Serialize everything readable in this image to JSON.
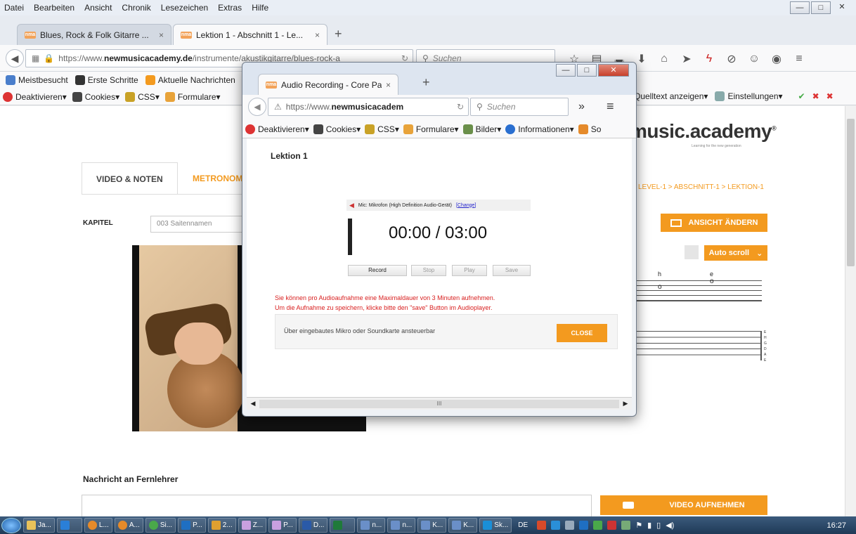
{
  "menubar": {
    "items": [
      "Datei",
      "Bearbeiten",
      "Ansicht",
      "Chronik",
      "Lesezeichen",
      "Extras",
      "Hilfe"
    ]
  },
  "tabs": [
    {
      "label": "Blues, Rock & Folk Gitarre ...",
      "favicon": "nma"
    },
    {
      "label": "Lektion 1 - Abschnitt 1 - Le...",
      "favicon": "nma"
    }
  ],
  "navbar": {
    "url_prefix": "https://www.",
    "url_domain": "newmusicacademy.de",
    "url_path": "/instrumente/akustikgitarre/blues-rock-a",
    "search_placeholder": "Suchen"
  },
  "bookmarks": [
    "Meistbesucht",
    "Erste Schritte",
    "Aktuelle Nachrichten"
  ],
  "webdev": [
    "Deaktivieren",
    "Cookies",
    "CSS",
    "Formulare"
  ],
  "webdev_right": [
    "Quelltext anzeigen",
    "Einstellungen"
  ],
  "page": {
    "logo": "music.academy",
    "logo_tagline": "Learning for the new generation",
    "tab_video": "VIDEO & NOTEN",
    "tab_metronom": "METRONOM",
    "breadcrumb": "LEVEL-1 > ABSCHNITT-1 > LEKTION-1",
    "kapitel_label": "KAPITEL",
    "kapitel_value": "003 Saitennamen",
    "ansicht_btn": "ANSICHT ÄNDERN",
    "autoscroll_btn": "Auto scroll",
    "note_h": "h",
    "note_e": "e",
    "tab_letters": [
      "E",
      "H",
      "G",
      "D",
      "A",
      "E"
    ],
    "message_label": "Nachricht an Fernlehrer",
    "video_btn": "VIDEO AUFNEHMEN"
  },
  "popup": {
    "tab_label": "Audio Recording - Core Pa...",
    "url_prefix": "https://www.",
    "url_domain": "newmusicacadem",
    "search_placeholder": "Suchen",
    "toolbar": [
      "Deaktivieren",
      "Cookies",
      "CSS",
      "Formulare",
      "Bilder",
      "Informationen",
      "So"
    ],
    "heading": "Lektion 1",
    "mic_label": "Mic: Mikrofon (High Definition Audio-Gerät)",
    "mic_change": "[Change]",
    "timer": "00:00 / 03:00",
    "btn_record": "Record",
    "btn_stop": "Stop",
    "btn_play": "Play",
    "btn_save": "Save",
    "warn1": "Sie können pro Audioaufnahme eine Maximaldauer von 3 Minuten aufnehmen.",
    "warn2": "Um die Aufnahme zu speichern, klicke bitte den \"save\" Button im Audioplayer.",
    "info_text": "Über eingebautes Mikro oder Soundkarte ansteuerbar",
    "close_btn": "CLOSE",
    "scroll_mark": "III"
  },
  "taskbar": {
    "items": [
      "Ja...",
      "L...",
      "A...",
      "Si...",
      "P...",
      "2...",
      "Z...",
      "P...",
      "D...",
      "",
      "n...",
      "n...",
      "K...",
      "K...",
      "Sk..."
    ],
    "lang": "DE",
    "clock": "16:27"
  },
  "colors": {
    "accent": "#f39a1f",
    "warn": "#d81e1e"
  }
}
